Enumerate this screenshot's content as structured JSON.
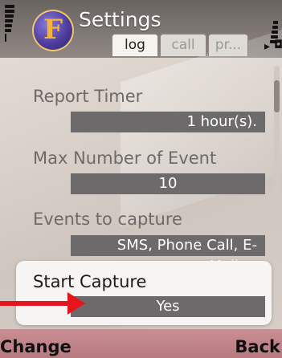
{
  "header": {
    "title": "Settings",
    "tabs": [
      {
        "label": "log",
        "active": true
      },
      {
        "label": "call",
        "active": false
      },
      {
        "label": "pr...",
        "active": false
      }
    ]
  },
  "settings": [
    {
      "label": "Report Timer",
      "value": "1 hour(s)."
    },
    {
      "label": "Max Number of Event",
      "value": "10"
    },
    {
      "label": "Events to capture",
      "value": "SMS, Phone Call, E-Mail,..."
    },
    {
      "label": "Start Capture",
      "value": "Yes",
      "selected": true
    }
  ],
  "softkeys": {
    "left": "Change",
    "right": "Back"
  },
  "colors": {
    "arrow": "#e8141b",
    "value_bar": "#6d6a6b",
    "accent_bottom": "#b77980"
  },
  "icons": [
    "signal-strength-icon",
    "battery-icon",
    "app-logo-icon",
    "tab-scroll-arrow-icon",
    "annotation-arrow-icon"
  ]
}
